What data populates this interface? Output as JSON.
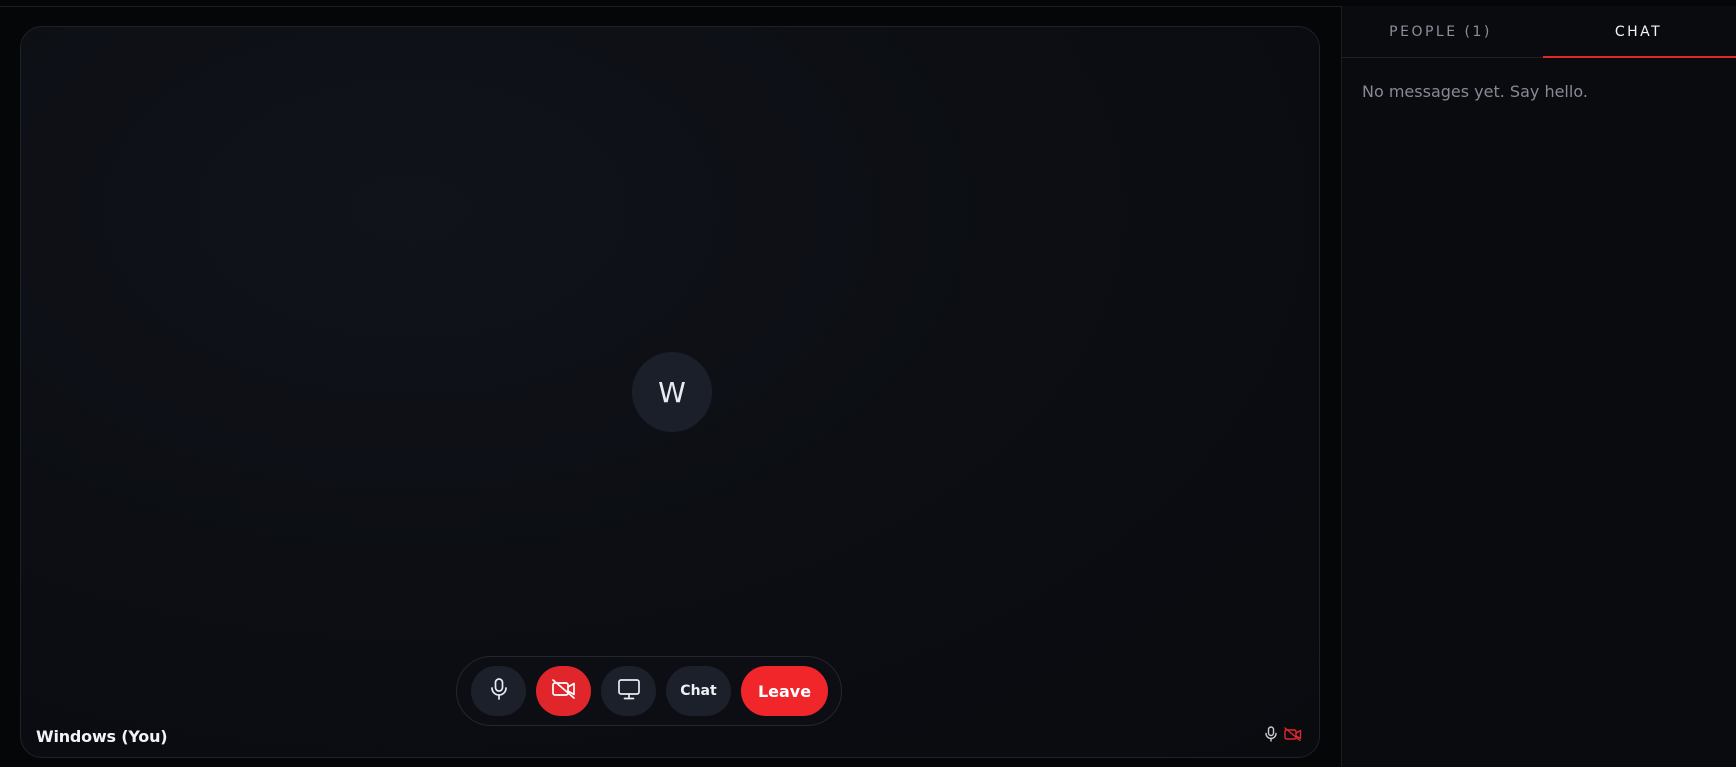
{
  "tile": {
    "avatar_initial": "W",
    "participant_name": "Windows (You)",
    "mic_status_icon": "mic-icon",
    "camera_status_icon": "camera-off-icon"
  },
  "controls": {
    "mic_icon": "mic-icon",
    "camera_icon": "camera-off-icon",
    "share_icon": "monitor-icon",
    "chat_label": "Chat",
    "leave_label": "Leave"
  },
  "panel": {
    "tabs": [
      {
        "label": "PEOPLE (1)",
        "active": false
      },
      {
        "label": "CHAT",
        "active": true
      }
    ],
    "empty_message": "No messages yet. Say hello."
  },
  "colors": {
    "accent": "#e2272c",
    "danger_button": "#e0262b",
    "leave_button": "#f1262b",
    "button_bg": "#1c202b",
    "background": "#050608"
  }
}
